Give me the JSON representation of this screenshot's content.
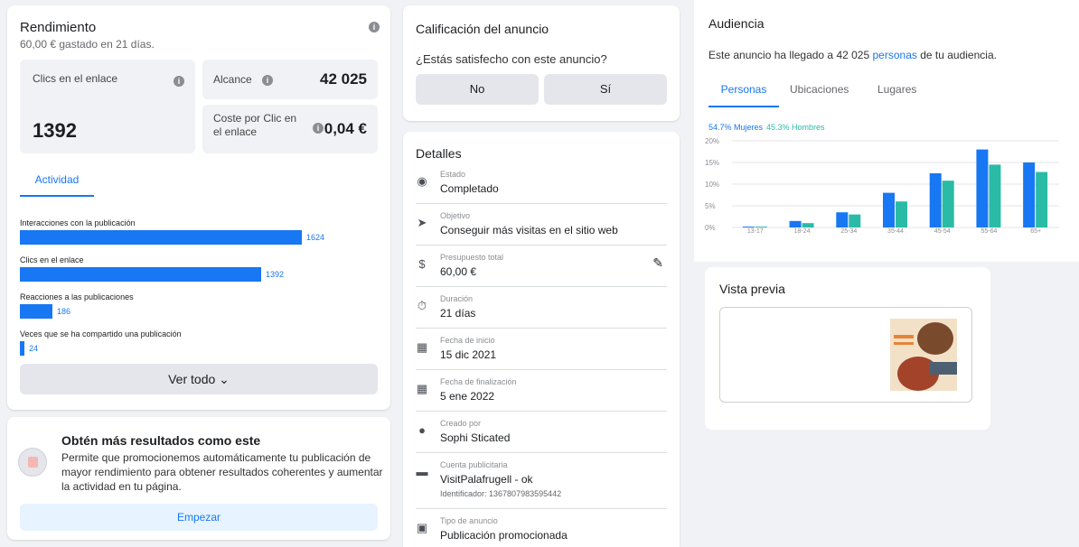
{
  "rendimiento": {
    "title": "Rendimiento",
    "subtitle": "60,00 € gastado en 21 días.",
    "clics_label": "Clics en el enlace",
    "clics_value": "1392",
    "alcance_label": "Alcance",
    "alcance_value": "42 025",
    "coste_label": "Coste por Clic en el enlace",
    "coste_value": "0,04 €",
    "tab": "Actividad",
    "bars": [
      {
        "label": "Interacciones con la publicación",
        "value": 1624
      },
      {
        "label": "Clics en el enlace",
        "value": 1392
      },
      {
        "label": "Reacciones a las publicaciones",
        "value": 186
      },
      {
        "label": "Veces que se ha compartido una publicación",
        "value": 24
      }
    ],
    "bar_color": "#1877f2",
    "ver_todo": "Ver todo"
  },
  "obten": {
    "title": "Obtén más resultados como este",
    "desc": "Permite que promocionemos automáticamente tu publicación de mayor rendimiento para obtener resultados coherentes y aumentar la actividad en tu página.",
    "button": "Empezar"
  },
  "calificacion": {
    "title": "Calificación del anuncio",
    "question": "¿Estás satisfecho con este anuncio?",
    "no": "No",
    "si": "Sí"
  },
  "detalles": {
    "title": "Detalles",
    "rows": [
      {
        "icon": "status-icon",
        "label": "Estado",
        "value": "Completado"
      },
      {
        "icon": "cursor-icon",
        "label": "Objetivo",
        "value": "Conseguir más visitas en el sitio web"
      },
      {
        "icon": "dollar-icon",
        "label": "Presupuesto total",
        "value": "60,00 €"
      },
      {
        "icon": "stopwatch-icon",
        "label": "Duración",
        "value": "21 días"
      },
      {
        "icon": "calendar-icon",
        "label": "Fecha de inicio",
        "value": "15 dic 2021"
      },
      {
        "icon": "calendar-icon",
        "label": "Fecha de finalización",
        "value": "5 ene 2022"
      },
      {
        "icon": "person-icon",
        "label": "Creado por",
        "value": "Sophi Sticated"
      },
      {
        "icon": "card-icon",
        "label": "Cuenta publicitaria",
        "value": "VisitPalafrugell - ok",
        "extra": "Identificador: 1367807983595442"
      },
      {
        "icon": "ad-type-icon",
        "label": "Tipo de anuncio",
        "value": "Publicación promocionada"
      }
    ]
  },
  "audiencia": {
    "title": "Audiencia",
    "desc_pre": "Este anuncio ha llegado a 42 025",
    "desc_link": "personas",
    "desc_post": "de tu audiencia.",
    "tabs": [
      "Personas",
      "Ubicaciones",
      "Lugares"
    ],
    "legend_women": "54.7% Mujeres",
    "legend_men": "45.3% Hombres"
  },
  "chart_data": {
    "type": "bar",
    "categories": [
      "13-17",
      "18-24",
      "25-34",
      "35-44",
      "45-54",
      "55-64",
      "65+"
    ],
    "series": [
      {
        "name": "Mujeres",
        "color": "#1877f2",
        "values": [
          0.2,
          1.5,
          3.5,
          8.0,
          12.5,
          18.0,
          15.0
        ]
      },
      {
        "name": "Hombres",
        "color": "#2abba7",
        "values": [
          0.2,
          1.0,
          3.0,
          6.0,
          10.8,
          14.5,
          12.8
        ]
      }
    ],
    "yticks": [
      "0%",
      "5%",
      "10%",
      "15%",
      "20%"
    ],
    "ylim": [
      0,
      20
    ]
  },
  "vista_previa": {
    "title": "Vista previa"
  }
}
